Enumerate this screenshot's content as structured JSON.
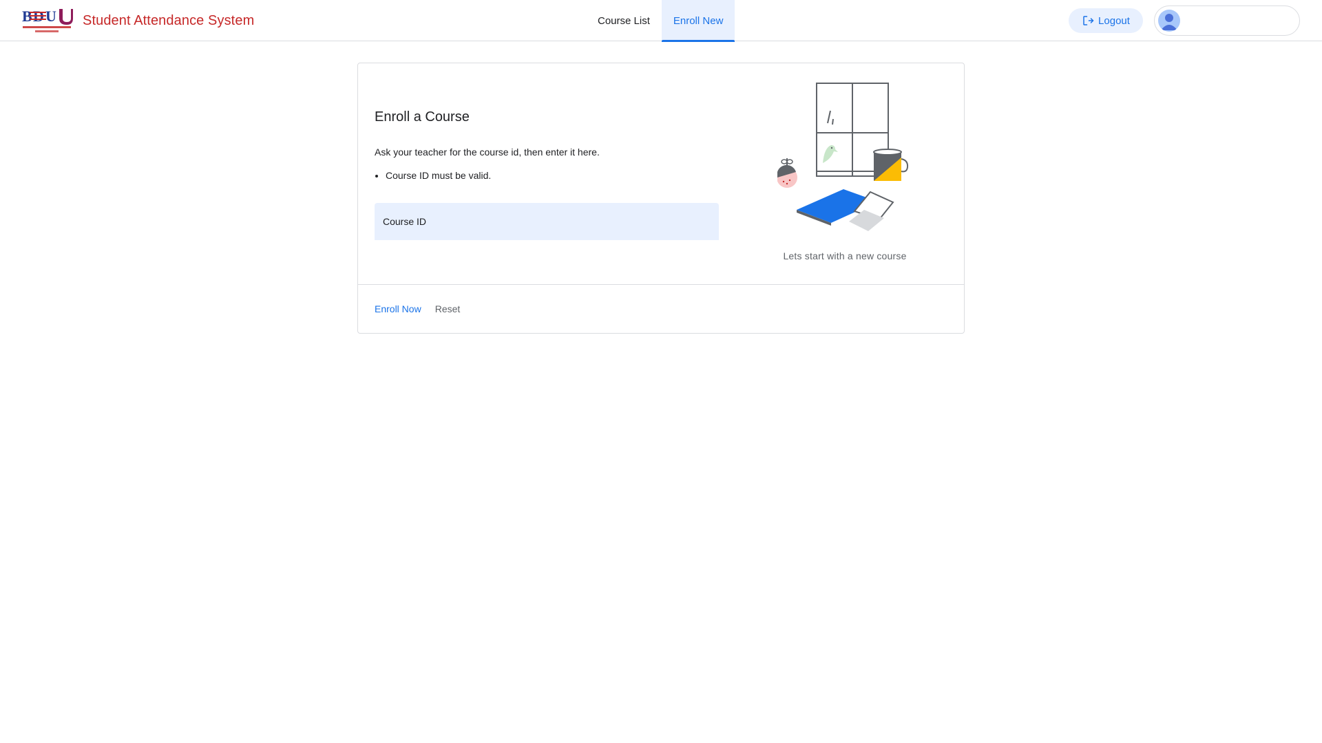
{
  "header": {
    "logo_icon": "university-logo",
    "app_title": "Student Attendance System",
    "nav": [
      {
        "label": "Course List",
        "active": false
      },
      {
        "label": "Enroll New",
        "active": true
      }
    ],
    "logout_label": "Logout",
    "logout_icon": "logout-icon",
    "avatar_icon": "user-avatar-icon"
  },
  "enroll_card": {
    "title": "Enroll a Course",
    "description": "Ask your teacher for the course id, then enter it here.",
    "rules": [
      "Course ID must be valid."
    ],
    "input": {
      "placeholder": "Course ID",
      "value": ""
    },
    "illustration_icon": "desk-illustration",
    "illustration_caption": "Lets start with a new course",
    "actions": {
      "enroll_label": "Enroll Now",
      "reset_label": "Reset"
    }
  },
  "colors": {
    "brand_red": "#c62828",
    "accent_blue": "#1a73e8",
    "active_tab_bg": "#e8f0fe",
    "input_bg": "#e8f0fe",
    "illustration_yellow": "#fbbc04",
    "illustration_pink": "#f8c6c6"
  }
}
